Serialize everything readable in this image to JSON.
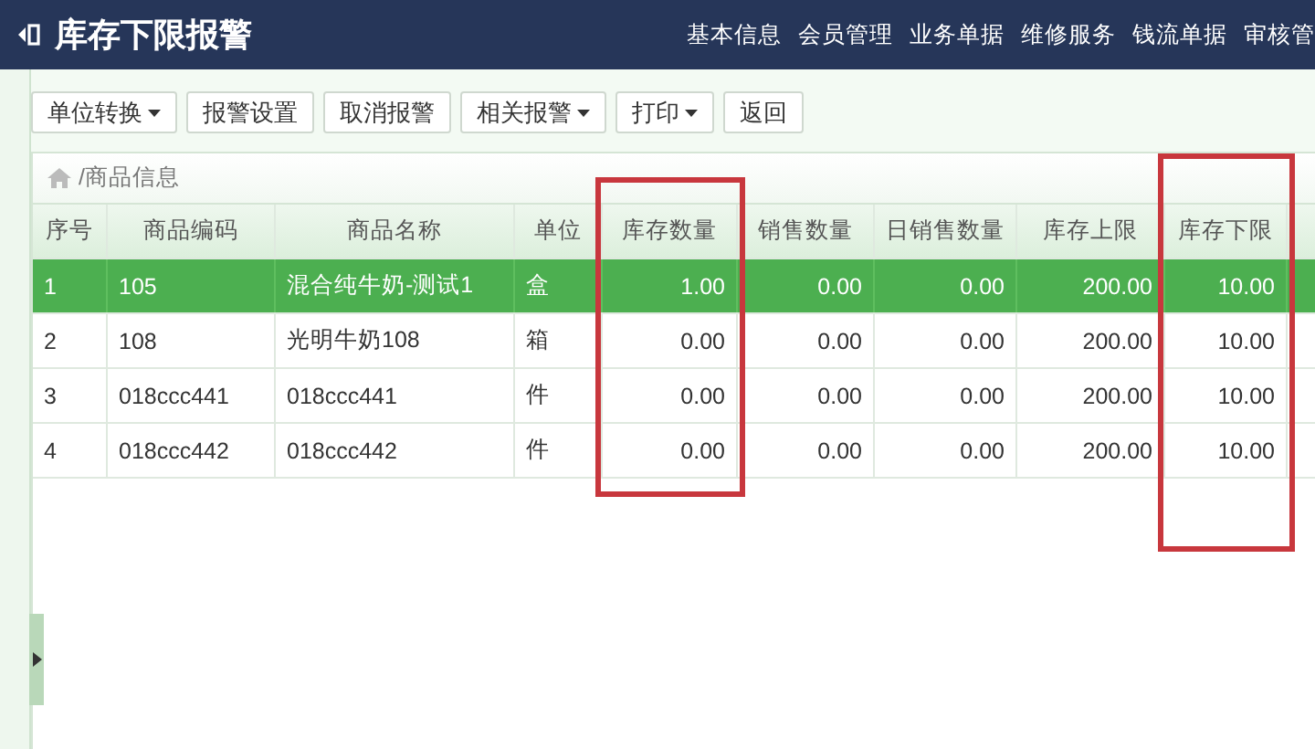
{
  "header": {
    "title": "库存下限报警",
    "nav": [
      "基本信息",
      "会员管理",
      "业务单据",
      "维修服务",
      "钱流单据",
      "审核管"
    ]
  },
  "toolbar": [
    {
      "label": "单位转换",
      "dropdown": true
    },
    {
      "label": "报警设置",
      "dropdown": false
    },
    {
      "label": "取消报警",
      "dropdown": false
    },
    {
      "label": "相关报警",
      "dropdown": true
    },
    {
      "label": "打印",
      "dropdown": true
    },
    {
      "label": "返回",
      "dropdown": false
    }
  ],
  "breadcrumb": "/商品信息",
  "table": {
    "columns": [
      {
        "label": "序号",
        "highlighted": false
      },
      {
        "label": "商品编码",
        "highlighted": false
      },
      {
        "label": "商品名称",
        "highlighted": false
      },
      {
        "label": "单位",
        "highlighted": false
      },
      {
        "label": "库存数量",
        "highlighted": true
      },
      {
        "label": "销售数量",
        "highlighted": false
      },
      {
        "label": "日销售数量",
        "highlighted": false
      },
      {
        "label": "库存上限",
        "highlighted": false
      },
      {
        "label": "库存下限",
        "highlighted": true
      }
    ],
    "rows": [
      {
        "selected": true,
        "cells": [
          "1",
          "105",
          "混合纯牛奶-测试1",
          "盒",
          "1.00",
          "0.00",
          "0.00",
          "200.00",
          "10.00"
        ]
      },
      {
        "selected": false,
        "cells": [
          "2",
          "108",
          "光明牛奶108",
          "箱",
          "0.00",
          "0.00",
          "0.00",
          "200.00",
          "10.00"
        ]
      },
      {
        "selected": false,
        "cells": [
          "3",
          "018ccc441",
          "018ccc441",
          "件",
          "0.00",
          "0.00",
          "0.00",
          "200.00",
          "10.00"
        ]
      },
      {
        "selected": false,
        "cells": [
          "4",
          "018ccc442",
          "018ccc442",
          "件",
          "0.00",
          "0.00",
          "0.00",
          "200.00",
          "10.00"
        ]
      }
    ]
  }
}
